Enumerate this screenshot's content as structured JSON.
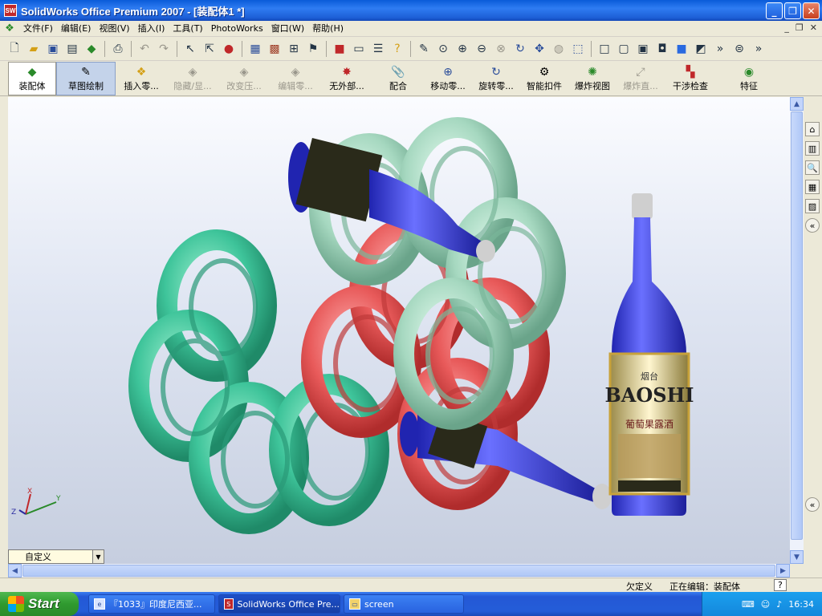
{
  "window": {
    "title": "SolidWorks Office Premium 2007 - [装配体1 *]",
    "app_icon_text": "SW",
    "min": "_",
    "restore": "❐",
    "close": "✕"
  },
  "menubar": {
    "items": [
      "文件(F)",
      "编辑(E)",
      "视图(V)",
      "插入(I)",
      "工具(T)",
      "PhotoWorks",
      "窗口(W)",
      "帮助(H)"
    ],
    "doc_controls": [
      "_",
      "❐",
      "✕"
    ]
  },
  "commandmanager": {
    "buttons": [
      {
        "label": "装配体",
        "state": "active"
      },
      {
        "label": "草图绘制",
        "state": "pressed"
      },
      {
        "label": "插入零...",
        "state": "normal"
      },
      {
        "label": "隐藏/显...",
        "state": "disabled"
      },
      {
        "label": "改变压...",
        "state": "disabled"
      },
      {
        "label": "编辑零...",
        "state": "disabled"
      },
      {
        "label": "无外部...",
        "state": "normal"
      },
      {
        "label": "配合",
        "state": "normal"
      },
      {
        "label": "移动零...",
        "state": "normal"
      },
      {
        "label": "旋转零...",
        "state": "normal"
      },
      {
        "label": "智能扣件",
        "state": "normal"
      },
      {
        "label": "爆炸视图",
        "state": "normal"
      },
      {
        "label": "爆炸直...",
        "state": "disabled"
      },
      {
        "label": "干涉检查",
        "state": "normal"
      },
      {
        "label": "特征",
        "state": "normal"
      }
    ]
  },
  "viewport": {
    "bottle_label": "BAOSHI",
    "bottle_label_top": "烟台",
    "bottle_label_sub": "葡萄果露酒",
    "triad_axes": [
      "X",
      "Y",
      "Z"
    ]
  },
  "view_combo": {
    "value": "自定义"
  },
  "statusbar": {
    "left": "欠定义",
    "right": "正在编辑：装配体",
    "help": "?"
  },
  "taskbar": {
    "start": "Start",
    "items": [
      {
        "label": "『1033』印度尼西亚...",
        "active": false
      },
      {
        "label": "SolidWorks Office Pre...",
        "active": true
      },
      {
        "label": "screen",
        "active": false
      }
    ],
    "clock": "16:34"
  },
  "colors": {
    "ring_green": "#3ec49a",
    "ring_mint": "#a6d8c0",
    "ring_red": "#e85a5a",
    "bottle_blue": "#3b3fe0"
  }
}
